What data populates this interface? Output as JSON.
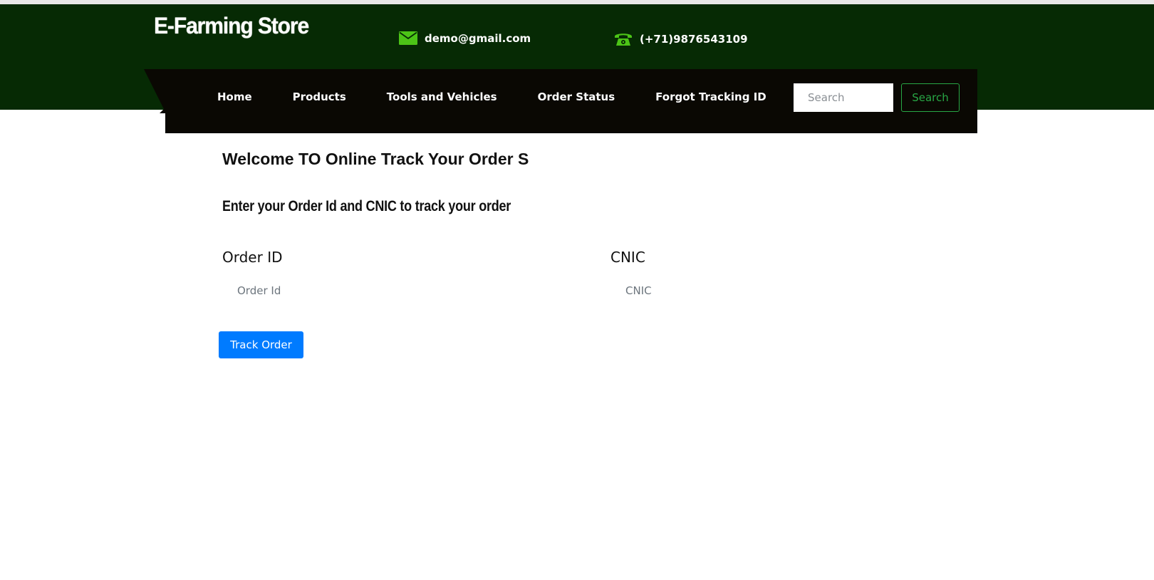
{
  "header": {
    "brand": "E-Farming Store",
    "email": "demo@gmail.com",
    "phone": "(+71)9876543109"
  },
  "nav": {
    "items": [
      {
        "label": "Home"
      },
      {
        "label": "Products"
      },
      {
        "label": "Tools and Vehicles"
      },
      {
        "label": "Order Status"
      },
      {
        "label": "Forgot Tracking ID"
      }
    ],
    "search_placeholder": "Search",
    "search_button": "Search"
  },
  "main": {
    "title": "Welcome TO Online Track Your Order S",
    "subtitle": "Enter your Order Id and CNIC to track your order",
    "order_id": {
      "label": "Order ID",
      "placeholder": "Order Id",
      "value": ""
    },
    "cnic": {
      "label": "CNIC",
      "placeholder": "CNIC",
      "value": ""
    },
    "track_button": "Track Order"
  },
  "colors": {
    "header_bg": "#062a04",
    "navbar_bg": "#0a0803",
    "icon_green": "#4cc417",
    "search_button": "#28a745",
    "primary_button": "#007bff"
  },
  "icons": {
    "email": "envelope-icon",
    "phone": "telephone-icon"
  }
}
